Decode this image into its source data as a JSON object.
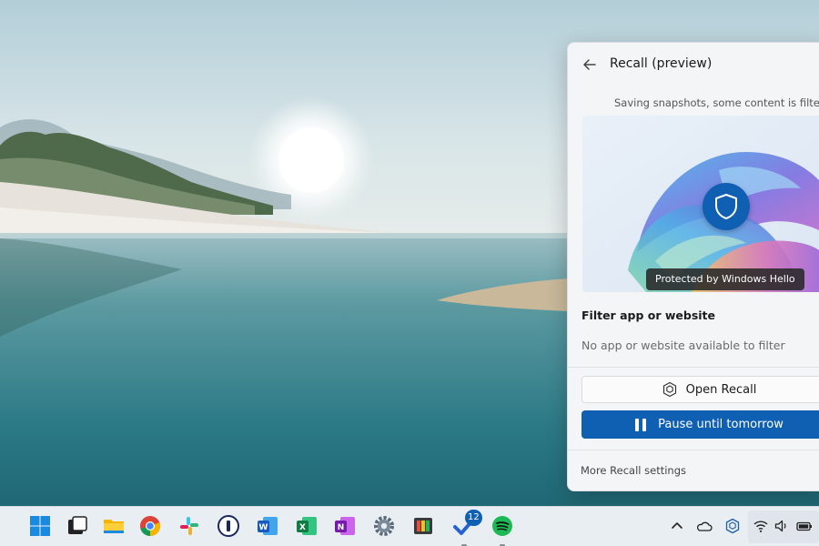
{
  "recall": {
    "title": "Recall (preview)",
    "status": "Saving snapshots, some content is filtered",
    "hello_badge": "Protected by Windows Hello",
    "filter_heading": "Filter app or website",
    "filter_empty": "No app or website available to filter",
    "open_button": "Open Recall",
    "pause_button": "Pause until tomorrow",
    "settings_link": "More Recall settings"
  },
  "taskbar": {
    "apps": [
      {
        "name": "Start",
        "icon": "windows-start-icon"
      },
      {
        "name": "Task View",
        "icon": "task-view-icon"
      },
      {
        "name": "File Explorer",
        "icon": "file-explorer-icon"
      },
      {
        "name": "Chrome",
        "icon": "chrome-icon"
      },
      {
        "name": "Slack",
        "icon": "slack-icon"
      },
      {
        "name": "1Password",
        "icon": "1password-icon"
      },
      {
        "name": "Word",
        "icon": "word-icon"
      },
      {
        "name": "Excel",
        "icon": "excel-icon"
      },
      {
        "name": "OneNote",
        "icon": "onenote-icon"
      },
      {
        "name": "Settings",
        "icon": "settings-gear-icon"
      },
      {
        "name": "Photos",
        "icon": "photos-icon"
      },
      {
        "name": "To Do",
        "icon": "todo-icon"
      },
      {
        "name": "Spotify",
        "icon": "spotify-icon"
      }
    ],
    "todo_badge": "12"
  },
  "tray": {
    "icons": [
      "chevron-up-icon",
      "onedrive-icon",
      "recall-icon",
      "wifi-icon",
      "volume-icon",
      "battery-icon"
    ]
  },
  "colors": {
    "accent": "#0f5fb3",
    "panel_bg": "#f3f5f7",
    "taskbar_bg": "#e9eef2"
  }
}
